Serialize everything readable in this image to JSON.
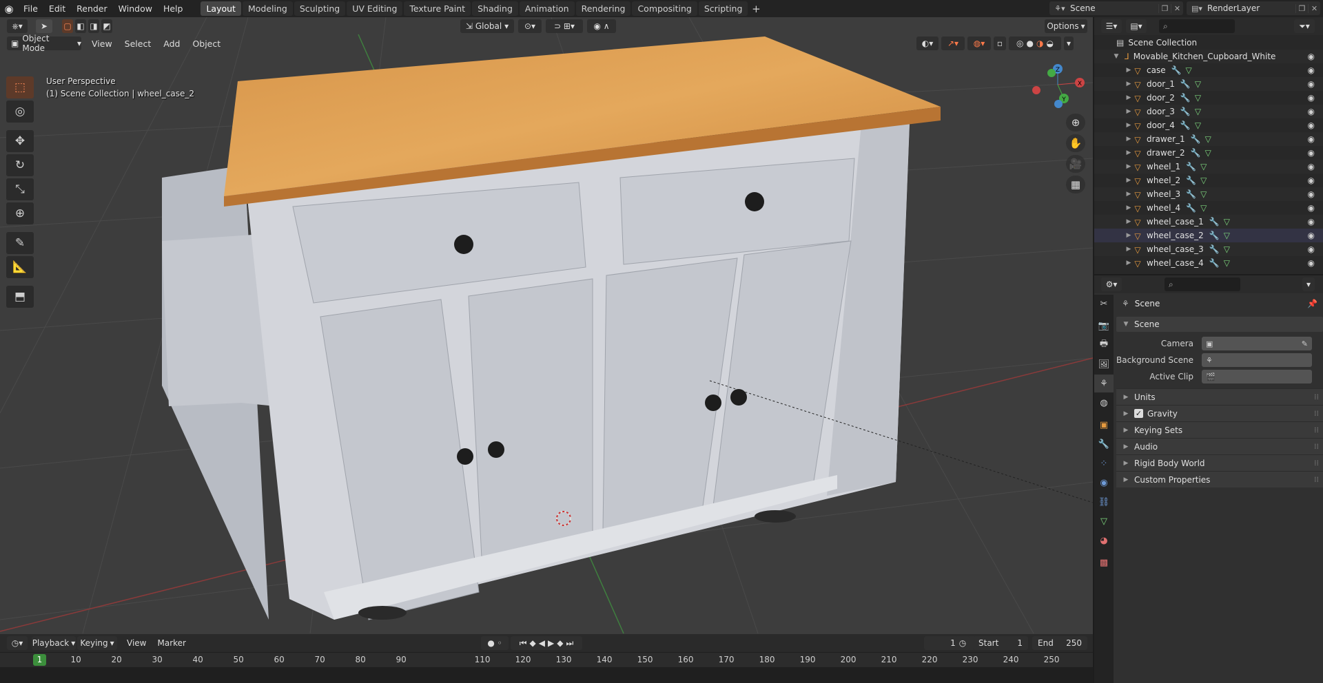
{
  "menu": [
    "File",
    "Edit",
    "Render",
    "Window",
    "Help"
  ],
  "workspaces": [
    "Layout",
    "Modeling",
    "Sculpting",
    "UV Editing",
    "Texture Paint",
    "Shading",
    "Animation",
    "Rendering",
    "Compositing",
    "Scripting"
  ],
  "active_workspace": "Layout",
  "scene_selector": {
    "label": "Scene"
  },
  "view_layer_selector": {
    "label": "RenderLayer"
  },
  "viewport": {
    "mode": "Object Mode",
    "menus": [
      "View",
      "Select",
      "Add",
      "Object"
    ],
    "transform_orientation": "Global",
    "options_label": "Options",
    "perspective_label": "User Perspective",
    "collection_label": "(1) Scene Collection | wheel_case_2"
  },
  "gizmo_axes": {
    "x": "X",
    "y": "Y",
    "z": "Z"
  },
  "timeline": {
    "playback_label": "Playback",
    "keying_label": "Keying",
    "view_label": "View",
    "marker_label": "Marker",
    "current_frame": "1",
    "start_label": "Start",
    "start_value": "1",
    "end_label": "End",
    "end_value": "250",
    "ticks": [
      "1",
      "10",
      "20",
      "30",
      "40",
      "50",
      "60",
      "70",
      "80",
      "90",
      "110",
      "120",
      "130",
      "140",
      "150",
      "160",
      "170",
      "180",
      "190",
      "200",
      "210",
      "220",
      "230",
      "240",
      "250"
    ]
  },
  "outliner": {
    "root": "Scene Collection",
    "collection": "Movable_Kitchen_Cupboard_White",
    "items": [
      "case",
      "door_1",
      "door_2",
      "door_3",
      "door_4",
      "drawer_1",
      "drawer_2",
      "wheel_1",
      "wheel_2",
      "wheel_3",
      "wheel_4",
      "wheel_case_1",
      "wheel_case_2",
      "wheel_case_3",
      "wheel_case_4"
    ],
    "selected": "wheel_case_2"
  },
  "properties": {
    "context_label": "Scene",
    "panel_title": "Scene",
    "fields": [
      {
        "label": "Camera",
        "value": ""
      },
      {
        "label": "Background Scene",
        "value": ""
      },
      {
        "label": "Active Clip",
        "value": ""
      }
    ],
    "subpanels": [
      "Units",
      "Gravity",
      "Keying Sets",
      "Audio",
      "Rigid Body World",
      "Custom Properties"
    ],
    "gravity_checked": true
  },
  "colors": {
    "accent_orange": "#e69a3f",
    "active_frame_green": "#3c8f3c",
    "viewport_bg": "#3d3d3d"
  }
}
